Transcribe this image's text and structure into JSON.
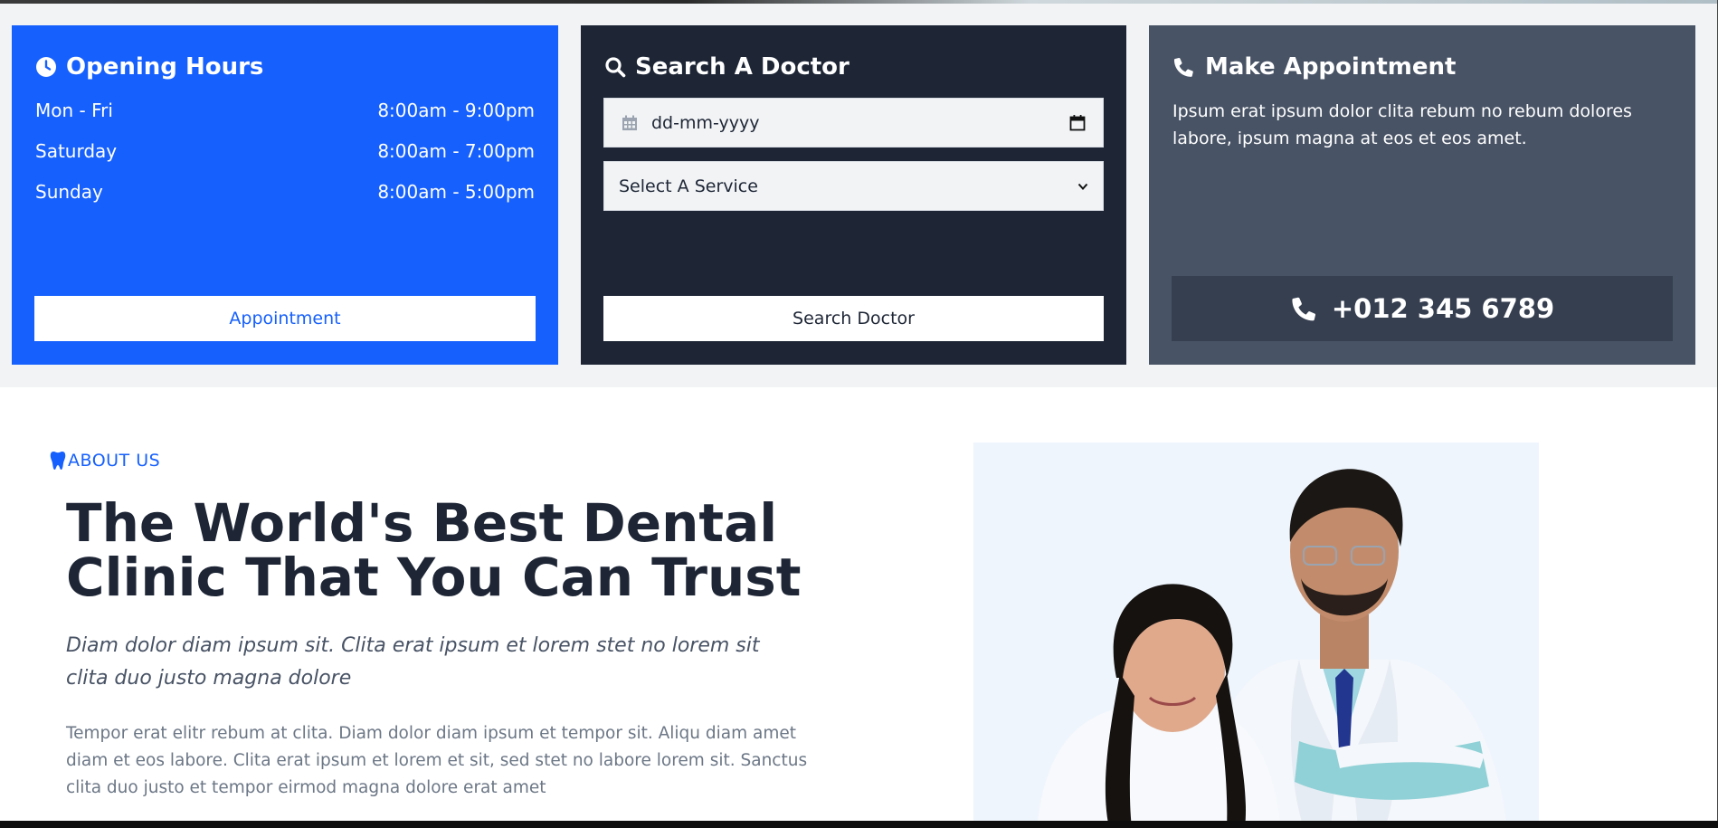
{
  "hours_card": {
    "title": "Opening Hours",
    "rows": [
      {
        "day": "Mon - Fri",
        "time": "8:00am - 9:00pm"
      },
      {
        "day": "Saturday",
        "time": "8:00am - 7:00pm"
      },
      {
        "day": "Sunday",
        "time": "8:00am - 5:00pm"
      }
    ],
    "button_label": "Appointment",
    "color": "#1660fd"
  },
  "search_card": {
    "title": "Search A Doctor",
    "date_placeholder": "dd-mm-yyyy",
    "service_selected": "Select A Service",
    "button_label": "Search Doctor",
    "color": "#1e2636"
  },
  "appointment_card": {
    "title": "Make Appointment",
    "description": "Ipsum erat ipsum dolor clita rebum no rebum dolores labore, ipsum magna at eos et eos amet.",
    "phone": "+012 345 6789",
    "color": "#485365"
  },
  "about": {
    "label": "ABOUT US",
    "title": "The World's Best Dental Clinic That You Can Trust",
    "lead": "Diam dolor diam ipsum sit. Clita erat ipsum et lorem stet no lorem sit clita duo justo magna dolore",
    "body": "Tempor erat elitr rebum at clita. Diam dolor diam ipsum et tempor sit. Aliqu diam amet diam et eos labore. Clita erat ipsum et lorem et sit, sed stet no labore lorem sit. Sanctus clita duo justo et tempor eirmod magna dolore erat amet"
  },
  "icons": {
    "hours": "clock-icon",
    "search": "search-icon",
    "appointment": "phone-icon",
    "date": "calendar-icon",
    "about": "tooth-icon"
  }
}
